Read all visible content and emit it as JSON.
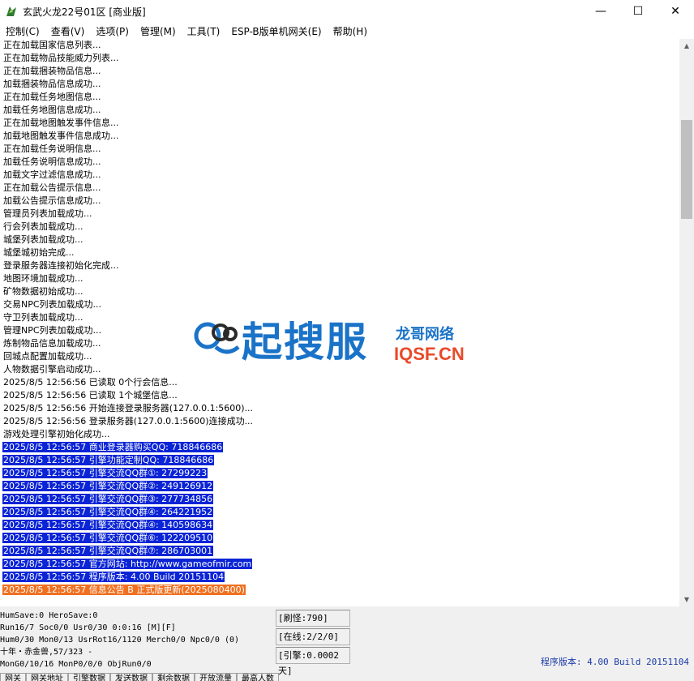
{
  "window": {
    "title": "玄武火龙22号01区 [商业版]",
    "minimize_glyph": "—",
    "maximize_glyph": "☐",
    "close_glyph": "✕"
  },
  "menu": [
    "控制(C)",
    "查看(V)",
    "选项(P)",
    "管理(M)",
    "工具(T)",
    "ESP-B版单机网关(E)",
    "帮助(H)"
  ],
  "log": [
    {
      "text": "正在加载国家信息列表...",
      "hl": ""
    },
    {
      "text": "正在加载物品技能威力列表...",
      "hl": ""
    },
    {
      "text": "正在加载捆装物品信息...",
      "hl": ""
    },
    {
      "text": "加载捆装物品信息成功...",
      "hl": ""
    },
    {
      "text": "正在加载任务地图信息...",
      "hl": ""
    },
    {
      "text": "加载任务地图信息成功...",
      "hl": ""
    },
    {
      "text": "正在加载地图触发事件信息...",
      "hl": ""
    },
    {
      "text": "加载地图触发事件信息成功...",
      "hl": ""
    },
    {
      "text": "正在加载任务说明信息...",
      "hl": ""
    },
    {
      "text": "加载任务说明信息成功...",
      "hl": ""
    },
    {
      "text": "加载文字过滤信息成功...",
      "hl": ""
    },
    {
      "text": "正在加载公告提示信息...",
      "hl": ""
    },
    {
      "text": "加载公告提示信息成功...",
      "hl": ""
    },
    {
      "text": "管理员列表加载成功...",
      "hl": ""
    },
    {
      "text": "行会列表加载成功...",
      "hl": ""
    },
    {
      "text": "城堡列表加载成功...",
      "hl": ""
    },
    {
      "text": "城堡城初始完成...",
      "hl": ""
    },
    {
      "text": "登录服务器连接初始化完成...",
      "hl": ""
    },
    {
      "text": "地图环境加载成功...",
      "hl": ""
    },
    {
      "text": "矿物数据初始成功...",
      "hl": ""
    },
    {
      "text": "交易NPC列表加载成功...",
      "hl": ""
    },
    {
      "text": "守卫列表加载成功...",
      "hl": ""
    },
    {
      "text": "管理NPC列表加载成功...",
      "hl": ""
    },
    {
      "text": "炼制物品信息加载成功...",
      "hl": ""
    },
    {
      "text": "回城点配置加载成功...",
      "hl": ""
    },
    {
      "text": "人物数据引擎启动成功...",
      "hl": ""
    },
    {
      "text": "2025/8/5 12:56:56 已读取 0个行会信息...",
      "hl": ""
    },
    {
      "text": "2025/8/5 12:56:56 已读取 1个城堡信息...",
      "hl": ""
    },
    {
      "text": "2025/8/5 12:56:56 开始连接登录服务器(127.0.0.1:5600)...",
      "hl": ""
    },
    {
      "text": "2025/8/5 12:56:56 登录服务器(127.0.0.1:5600)连接成功...",
      "hl": ""
    },
    {
      "text": "游戏处理引擎初始化成功...",
      "hl": ""
    },
    {
      "text": "2025/8/5 12:56:57 商业登录器购买QQ: 718846686",
      "hl": "blue"
    },
    {
      "text": "2025/8/5 12:56:57 引擎功能定制QQ: 718846686",
      "hl": "blue"
    },
    {
      "text": "2025/8/5 12:56:57 引擎交流QQ群①: 27299223",
      "hl": "blue"
    },
    {
      "text": "2025/8/5 12:56:57 引擎交流QQ群②: 249126912",
      "hl": "blue"
    },
    {
      "text": "2025/8/5 12:56:57 引擎交流QQ群③: 277734856",
      "hl": "blue"
    },
    {
      "text": "2025/8/5 12:56:57 引擎交流QQ群④: 264221952",
      "hl": "blue"
    },
    {
      "text": "2025/8/5 12:56:57 引擎交流QQ群④: 140598634",
      "hl": "blue"
    },
    {
      "text": "2025/8/5 12:56:57 引擎交流QQ群⑥: 122209510",
      "hl": "blue"
    },
    {
      "text": "2025/8/5 12:56:57 引擎交流QQ群⑦: 286703001",
      "hl": "blue"
    },
    {
      "text": "2025/8/5 12:56:57 官方网站: http://www.gameofmir.com",
      "hl": "blue"
    },
    {
      "text": "2025/8/5 12:56:57 程序版本: 4.00 Build 20151104",
      "hl": "blue"
    },
    {
      "text": "2025/8/5 12:56:57 信息公告 B 正式版更新(2025080400)",
      "hl": "orange"
    }
  ],
  "status": {
    "lines": [
      "HumSave:0 HeroSave:0",
      "Run16/7 Soc0/0 Usr0/30              0:0:16 [M][F]",
      "Hum0/30 Mon0/13 UsrRot16/1120 Merch0/0 Npc0/0 (0)",
      "十年・赤金兽,57/323 -",
      "MonG0/10/16 MonP0/0/0 ObjRun0/0"
    ],
    "mid": [
      "[刷怪:790]",
      "[在线:2/2/0]",
      "[引擎:0.0002天]"
    ],
    "version": "程序版本: 4.00 Build 20151104"
  },
  "tabs": [
    "网关",
    "网关地址",
    "引擎数据",
    "发送数据",
    "剩余数据",
    "开放流量",
    "最高人数"
  ],
  "watermark": {
    "main": "起搜服",
    "sub1": "龙哥网络",
    "sub2": "IQSF.CN"
  },
  "colors": {
    "highlight_blue": "#0a24d6",
    "highlight_orange": "#f07020",
    "version_text": "#1a3aa8"
  }
}
